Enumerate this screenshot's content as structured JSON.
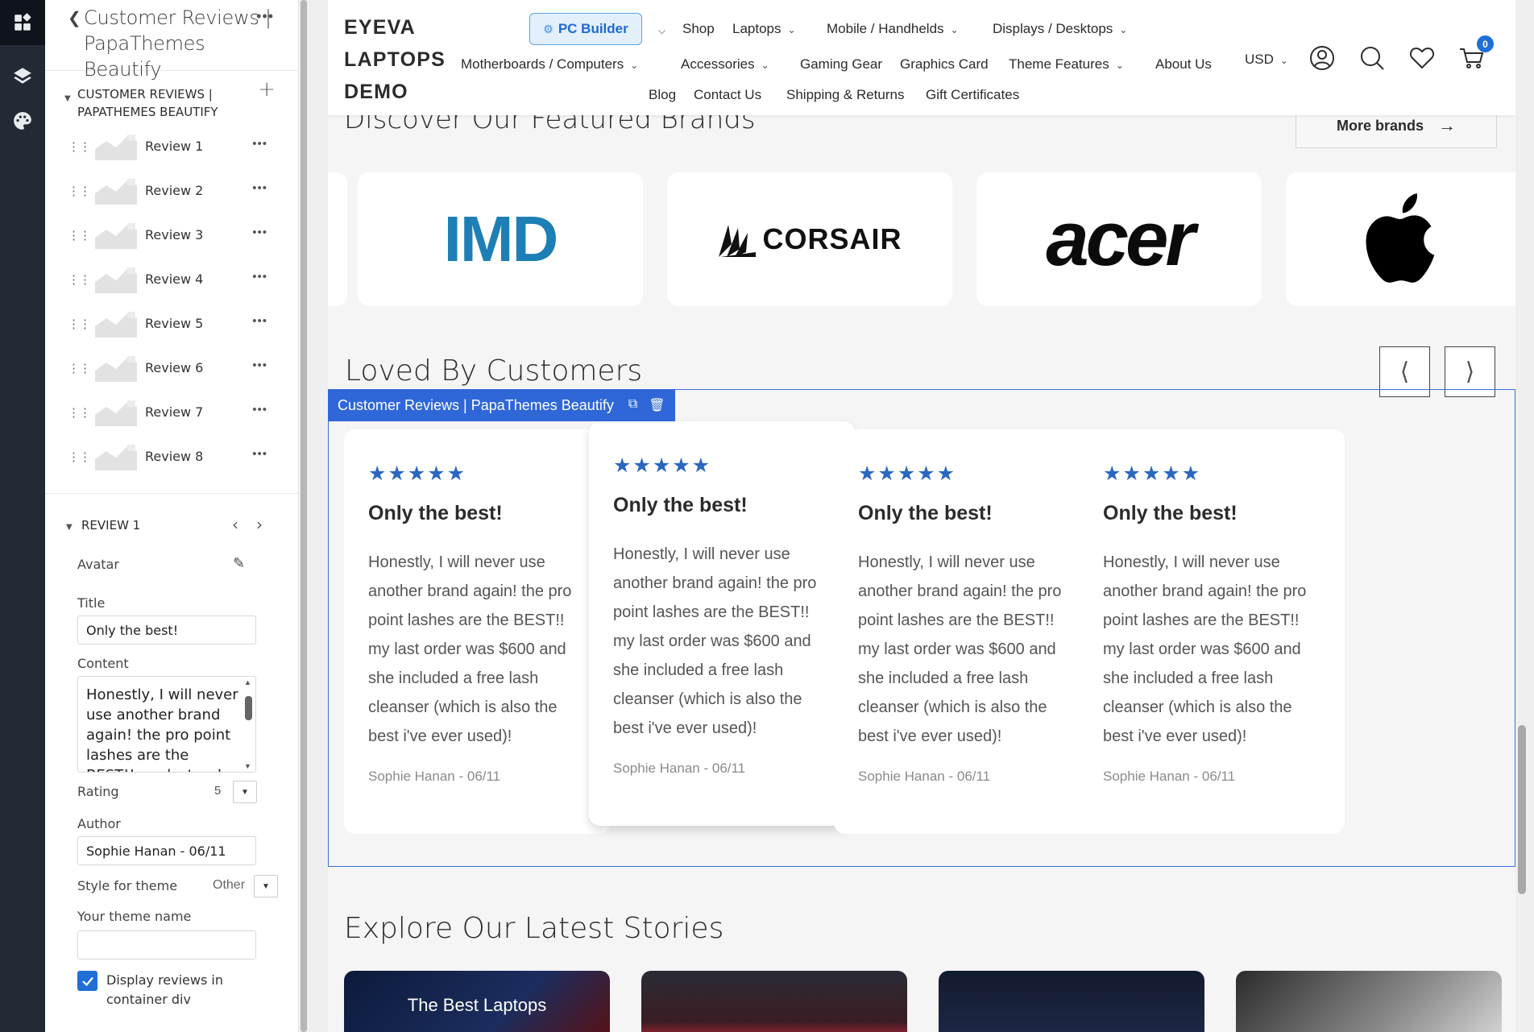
{
  "editor": {
    "back_title": "Customer Reviews | PapaThemes Beautify",
    "section_title": "CUSTOMER REVIEWS | PAPATHEMES BEAUTIFY",
    "reviews": [
      "Review 1",
      "Review 2",
      "Review 3",
      "Review 4",
      "Review 5",
      "Review 6",
      "Review 7",
      "Review 8"
    ],
    "current_review": "REVIEW 1",
    "fields": {
      "avatar_label": "Avatar",
      "title_label": "Title",
      "title_value": "Only the best!",
      "content_label": "Content",
      "content_value": "Honestly, I will never use another brand again! the pro point lashes are the BEST!! my last order was $600 and she included a free lash cleanser (which is also the best i've ever used)!",
      "rating_label": "Rating",
      "rating_value": "5",
      "author_label": "Author",
      "author_value": "Sophie Hanan - 06/11",
      "style_label": "Style for theme",
      "style_value": "Other",
      "theme_name_label": "Your theme name",
      "theme_name_value": "",
      "display_container_label": "Display reviews in container div",
      "display_container_checked": true
    }
  },
  "site": {
    "logo": "EYEVA LAPTOPS DEMO",
    "nav": {
      "pc_builder": "PC Builder",
      "shop": "Shop",
      "laptops": "Laptops",
      "mobile": "Mobile / Handhelds",
      "displays": "Displays / Desktops",
      "motherboards": "Motherboards / Computers",
      "accessories": "Accessories",
      "gaming": "Gaming Gear",
      "graphics": "Graphics Card",
      "theme_features": "Theme Features",
      "about": "About Us",
      "blog": "Blog",
      "contact": "Contact Us",
      "shipping": "Shipping & Returns",
      "gift": "Gift Certificates"
    },
    "currency": "USD",
    "cart_count": "0",
    "brands_title": "Discover Our Featured Brands",
    "more_brands": "More brands",
    "brands": [
      "IMD",
      "CORSAIR",
      "acer",
      "apple"
    ],
    "loved_title": "Loved By Customers",
    "selected_widget": "Customer Reviews | PapaThemes Beautify",
    "review_cards": [
      {
        "stars": "★★★★★",
        "title": "Only the best!",
        "body": "Honestly, I will never use another brand again! the pro point lashes are the BEST!! my last order was $600 and she included a free lash cleanser (which is also the best i've ever used)!",
        "author": "Sophie Hanan - 06/11"
      },
      {
        "stars": "★★★★★",
        "title": "Only the best!",
        "body": "Honestly, I will never use another brand again! the pro point lashes are the BEST!! my last order was $600 and she included a free lash cleanser (which is also the best i've ever used)!",
        "author": "Sophie Hanan - 06/11"
      },
      {
        "stars": "★★★★★",
        "title": "Only the best!",
        "body": "Honestly, I will never use another brand again! the pro point lashes are the BEST!! my last order was $600 and she included a free lash cleanser (which is also the best i've ever used)!",
        "author": "Sophie Hanan - 06/11"
      },
      {
        "stars": "★★★★★",
        "title": "Only the best!",
        "body": "Honestly, I will never use another brand again! the pro point lashes are the BEST!! my last order was $600 and she included a free lash cleanser (which is also the best i've ever used)!",
        "author": "Sophie Hanan - 06/11"
      }
    ],
    "stories_title": "Explore Our Latest Stories",
    "story_1_text": "The Best Laptops"
  },
  "colors": {
    "accent": "#2f67d8",
    "star": "#2a67c1",
    "rail": "#232a36"
  }
}
